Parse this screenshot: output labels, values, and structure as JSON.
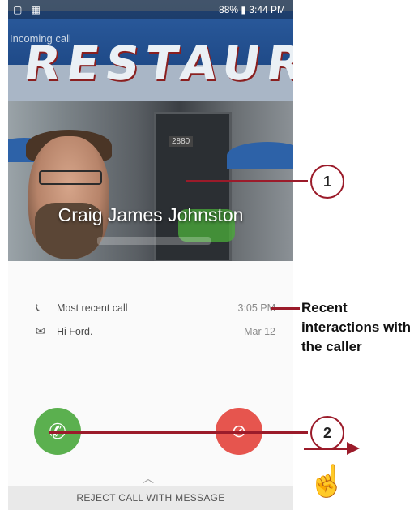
{
  "status_bar": {
    "left_icons": "▢ ▦",
    "right": "88% ▮ 3:44 PM"
  },
  "call": {
    "state": "Incoming call",
    "caller_name": "Craig James Johnston",
    "storefront_sign": "RESTAUR",
    "door_number": "2880"
  },
  "recent": [
    {
      "icon": "phone-icon",
      "label": "Most recent call",
      "time": "3:05 PM"
    },
    {
      "icon": "message-icon",
      "label": "Hi Ford.",
      "time": "Mar 12"
    }
  ],
  "actions": {
    "reject_with_message": "REJECT CALL WITH MESSAGE"
  },
  "callouts": {
    "one": "1",
    "two": "2",
    "recent_interactions": "Recent interactions with the caller"
  },
  "colors": {
    "accept": "#5bb04f",
    "decline": "#e6554e",
    "callout": "#9b1b2a"
  }
}
